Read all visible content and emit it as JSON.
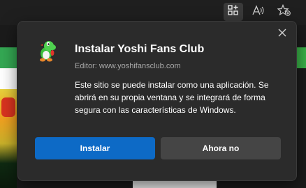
{
  "toolbar": {
    "icons": [
      "app-install-icon",
      "read-aloud-icon",
      "add-favorite-icon"
    ]
  },
  "popup": {
    "title": "Instalar Yoshi Fans Club",
    "publisher": "Editor: www.yoshifansclub.com",
    "description": "Este sitio se puede instalar como una aplicación. Se abrirá en su propia ventana y se integrará de forma segura con las características de Windows.",
    "install_label": "Instalar",
    "not_now_label": "Ahora no",
    "close_icon": "close-icon",
    "app_icon": "yoshi-app-icon"
  },
  "colors": {
    "accent": "#0d6ac6",
    "popup_bg": "#2b2b2b",
    "secondary_button": "#454545",
    "page_green": "#34a853"
  }
}
